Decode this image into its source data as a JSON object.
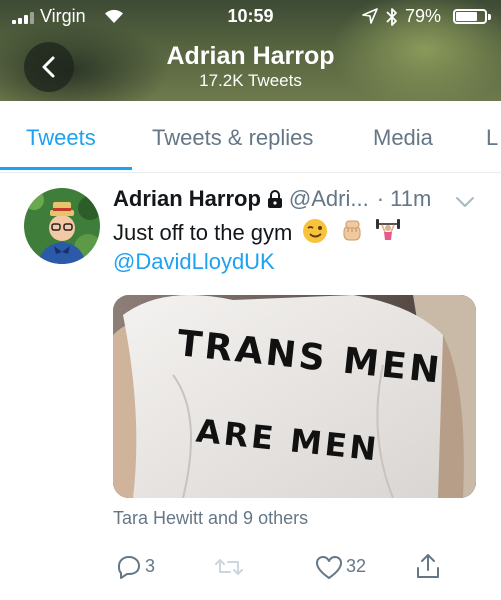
{
  "status_bar": {
    "carrier": "Virgin",
    "time": "10:59",
    "battery_percent": "79%",
    "battery_level": 0.79,
    "icons": [
      "signal-icon",
      "wifi-icon",
      "location-arrow-icon",
      "bluetooth-icon",
      "battery-icon"
    ]
  },
  "header": {
    "back_icon": "chevron-left-icon",
    "name": "Adrian Harrop",
    "tweet_count": "17.2K Tweets"
  },
  "tabs": [
    {
      "label": "Tweets",
      "active": true
    },
    {
      "label": "Tweets & replies",
      "active": false
    },
    {
      "label": "Media",
      "active": false
    },
    {
      "label": "L",
      "active": false
    }
  ],
  "tweet": {
    "author": "Adrian Harrop",
    "handle": "@Adri...",
    "time": "· 11m",
    "text": "Just off to the gym",
    "emojis": [
      "winking-face-emoji",
      "raised-fist-emoji",
      "weightlifter-emoji"
    ],
    "mention": "@DavidLloydUK",
    "image": {
      "shirt_line1": "TRANS MEN",
      "shirt_line2": "ARE MEN"
    },
    "liked_by": "Tara Hewitt and 9 others",
    "actions": {
      "reply_count": "3",
      "retweet_count": "",
      "like_count": "32"
    }
  },
  "colors": {
    "accent": "#1da1f2",
    "secondary_text": "#657786",
    "primary_text": "#14171a"
  }
}
